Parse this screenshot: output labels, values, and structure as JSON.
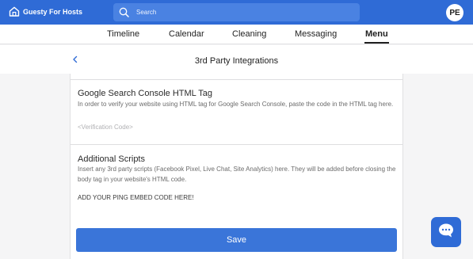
{
  "app": {
    "brand": "Guesty For Hosts"
  },
  "search": {
    "placeholder": "Search"
  },
  "user": {
    "initials": "PE"
  },
  "nav": {
    "tabs": [
      {
        "label": "Timeline"
      },
      {
        "label": "Calendar"
      },
      {
        "label": "Cleaning"
      },
      {
        "label": "Messaging"
      },
      {
        "label": "Menu",
        "active": true
      }
    ]
  },
  "page": {
    "title": "3rd Party Integrations"
  },
  "sections": [
    {
      "title": "Google Search Console HTML Tag",
      "description": "In order to verify your website using HTML tag for Google Search Console, paste the code in the HTML tag here.",
      "placeholder": "<Verification Code>"
    },
    {
      "title": "Additional Scripts",
      "description": "Insert any 3rd party scripts (Facebook Pixel, Live Chat, Site Analytics) here. They will be added before closing the body tag in your website's HTML code.",
      "value": "ADD YOUR PING EMBED CODE HERE!"
    }
  ],
  "actions": {
    "save_label": "Save"
  },
  "colors": {
    "primary": "#2f6bd6",
    "search_bg": "#4a82e2",
    "button": "#3a75d9"
  },
  "icons": {
    "brand": "home-icon",
    "search": "search-icon",
    "back": "chevron-left-icon",
    "chat": "chat-bubble-icon"
  }
}
